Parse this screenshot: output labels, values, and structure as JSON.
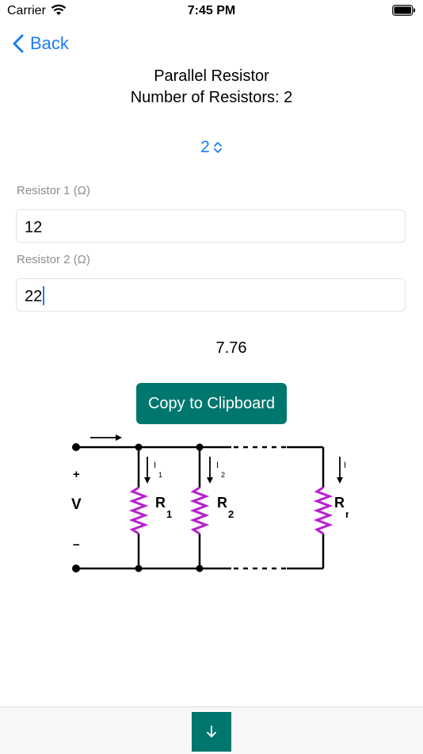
{
  "status": {
    "carrier": "Carrier",
    "time": "7:45 PM"
  },
  "nav": {
    "back_label": "Back"
  },
  "header": {
    "title": "Parallel Resistor",
    "subtitle": "Number of Resistors: 2"
  },
  "stepper": {
    "value": "2"
  },
  "fields": [
    {
      "label": "Resistor 1 (Ω)",
      "value": "12"
    },
    {
      "label": "Resistor 2 (Ω)",
      "value": "22"
    }
  ],
  "result": {
    "value": "7.76"
  },
  "copy_button": {
    "label": "Copy to Clipboard"
  },
  "diagram": {
    "plus": "+",
    "voltage": "V",
    "minus": "−",
    "r1": "R",
    "r1_sub": "1",
    "r2": "R",
    "r2_sub": "2",
    "rn": "R",
    "rn_sub": "n",
    "i1": "I",
    "i1_sub": "1",
    "i2": "I",
    "i2_sub": "2",
    "in": "I",
    "in_sub": "n"
  },
  "colors": {
    "accent": "#1a7cf5",
    "button": "#00776e",
    "resistor": "#b81fcf"
  }
}
